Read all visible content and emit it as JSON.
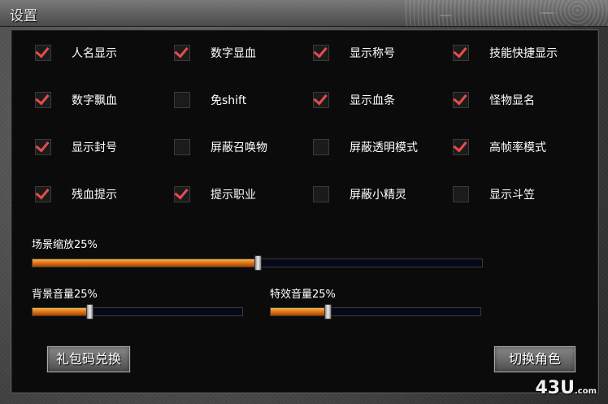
{
  "window": {
    "title": "设置"
  },
  "checkboxes": [
    {
      "label": "人名显示",
      "checked": true
    },
    {
      "label": "数字显血",
      "checked": true
    },
    {
      "label": "显示称号",
      "checked": true
    },
    {
      "label": "技能快捷显示",
      "checked": true
    },
    {
      "label": "数字飘血",
      "checked": true
    },
    {
      "label": "免shift",
      "checked": false
    },
    {
      "label": "显示血条",
      "checked": true
    },
    {
      "label": "怪物显名",
      "checked": true
    },
    {
      "label": "显示封号",
      "checked": true
    },
    {
      "label": "屏蔽召唤物",
      "checked": false
    },
    {
      "label": "屏蔽透明模式",
      "checked": false
    },
    {
      "label": "高帧率模式",
      "checked": true
    },
    {
      "label": "残血提示",
      "checked": true
    },
    {
      "label": "提示职业",
      "checked": true
    },
    {
      "label": "屏蔽小精灵",
      "checked": false
    },
    {
      "label": "显示斗笠",
      "checked": false
    }
  ],
  "sliders": {
    "scene_zoom": {
      "label": "场景缩放25%",
      "value": 0.5
    },
    "bg_volume": {
      "label": "背景音量25%",
      "value": 0.27
    },
    "fx_volume": {
      "label": "特效音量25%",
      "value": 0.27
    }
  },
  "buttons": {
    "gift_code": "礼包码兑换",
    "switch_role": "切换角色"
  },
  "watermark": {
    "main": "43U",
    "suffix": ".com"
  },
  "colors": {
    "accent": "#e54c4c",
    "slider_fill": "#e07a1a"
  }
}
